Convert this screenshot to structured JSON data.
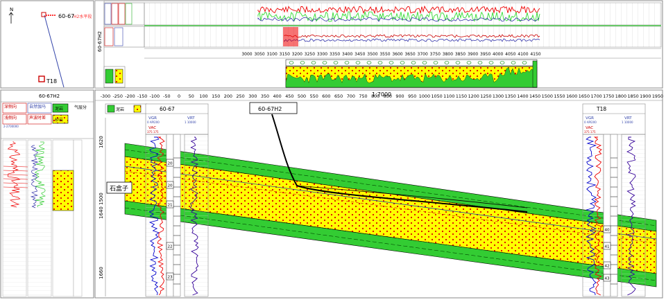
{
  "map": {
    "north": "N",
    "well_a": "60-67",
    "well_a_note": "H2水平段",
    "well_b": "T18"
  },
  "profile": {
    "well_name": "60-67H2",
    "scale_ticks": [
      "3000",
      "3050",
      "3100",
      "3150",
      "3200",
      "3250",
      "3300",
      "3350",
      "3400",
      "3450",
      "3500",
      "3550",
      "3600",
      "3650",
      "3700",
      "3750",
      "3800",
      "3850",
      "3900",
      "3950",
      "4000",
      "4050",
      "4100",
      "4150"
    ],
    "track_labels": [
      "自然伽马",
      "声波时差",
      "深侧向",
      "浅侧向"
    ],
    "lith_labels": [
      "泥岩",
      "砂岩"
    ]
  },
  "left_panel": {
    "well_name": "60-67H2",
    "header_cells": [
      "深侧向",
      "浅侧向",
      "自然伽马",
      "声波时差",
      "泥岩",
      "砂岩",
      "气层分"
    ],
    "sub_label": "2-2700000"
  },
  "section": {
    "top_axis": [
      "-300",
      "-250",
      "-200",
      "-150",
      "-100",
      "-50",
      "0",
      "50",
      "100",
      "150",
      "200",
      "250",
      "300",
      "350",
      "400",
      "450",
      "500",
      "550",
      "600",
      "650",
      "700",
      "750",
      "800",
      "850",
      "900",
      "950",
      "1000",
      "1050",
      "1100",
      "1150",
      "1200",
      "1250",
      "1300",
      "1350",
      "1400",
      "1450",
      "1500",
      "1550",
      "1600",
      "1650",
      "1700",
      "1750",
      "1800",
      "1850",
      "1900",
      "1950"
    ],
    "scale_label": "1:7000",
    "h_well_label": "60-67H2",
    "legend": [
      "泥岩",
      "砂岩"
    ],
    "formation": "石盒子",
    "depth_ticks": [
      "1620",
      "1500",
      "1640",
      "1660"
    ],
    "well_left": {
      "name": "60-67",
      "curve_a": "VGR",
      "curve_a_range": "0  API200",
      "curve_b": "VRT",
      "curve_b_range": "1  10000",
      "curve_c": "VAC",
      "curve_c_range": "375  175",
      "layers": [
        "20",
        "20",
        "21",
        "22",
        "23"
      ]
    },
    "well_right": {
      "name": "T18",
      "curve_a": "VGR",
      "curve_a_range": "0  API200",
      "curve_b": "VRT",
      "curve_b_range": "1  10000",
      "curve_c": "VAC",
      "curve_c_range": "375  175",
      "layers": [
        "40",
        "41",
        "42",
        "43"
      ]
    }
  },
  "colors": {
    "sand": "#ffff00",
    "shale": "#33cc33",
    "dot": "#dd0000",
    "grid": "#999999"
  }
}
